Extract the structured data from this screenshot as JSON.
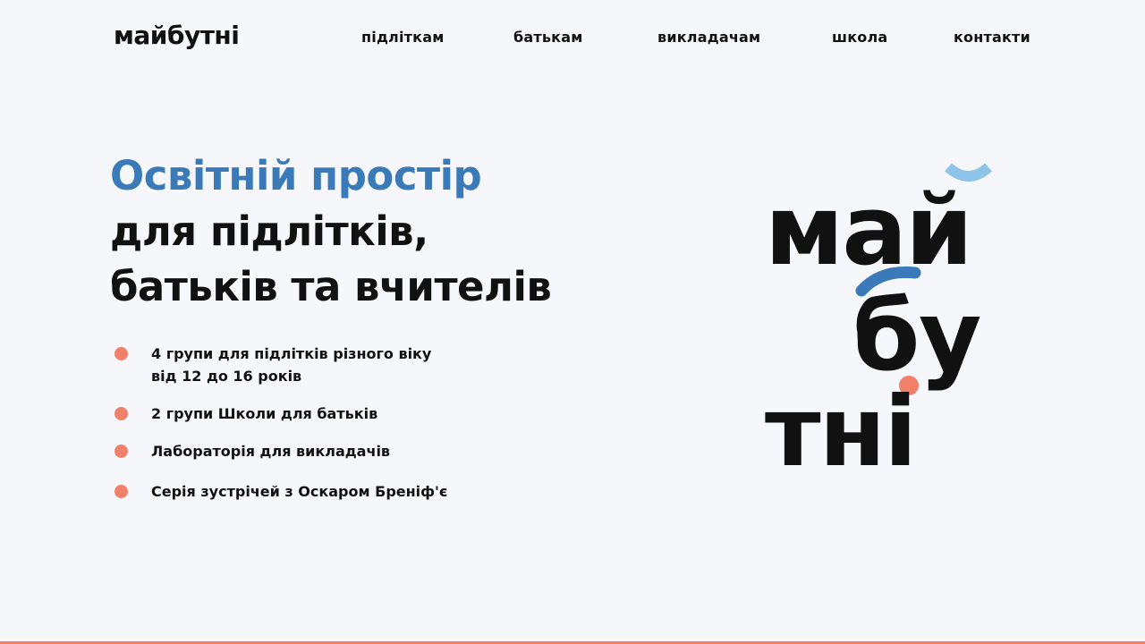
{
  "brand": {
    "logo_text": "майбутні"
  },
  "nav": {
    "items": [
      {
        "label": "підліткам"
      },
      {
        "label": "батькам"
      },
      {
        "label": "викладачам"
      },
      {
        "label": "школа"
      },
      {
        "label": "контакти"
      }
    ]
  },
  "hero": {
    "title_accent": "Освітній простір",
    "title_line1": "для підлітків,",
    "title_line2": "батьків та вчителів"
  },
  "features": [
    {
      "line1": "4 групи для підлітків різного віку",
      "line2": "від 12 до 16 років"
    },
    {
      "line1": "2 групи Школи для батьків"
    },
    {
      "line1": "Лабораторія для викладачів"
    },
    {
      "line1": "Серія зустрічей з Оскаром Бреніф'є"
    }
  ],
  "big_logo": {
    "row1": "май",
    "row2_a": "б",
    "row2_b": "у",
    "row3": "тні"
  },
  "colors": {
    "accent_blue": "#3a7ab8",
    "light_blue": "#8fc4ea",
    "coral": "#f0806a",
    "background": "#f5f7fa",
    "text": "#111111"
  }
}
